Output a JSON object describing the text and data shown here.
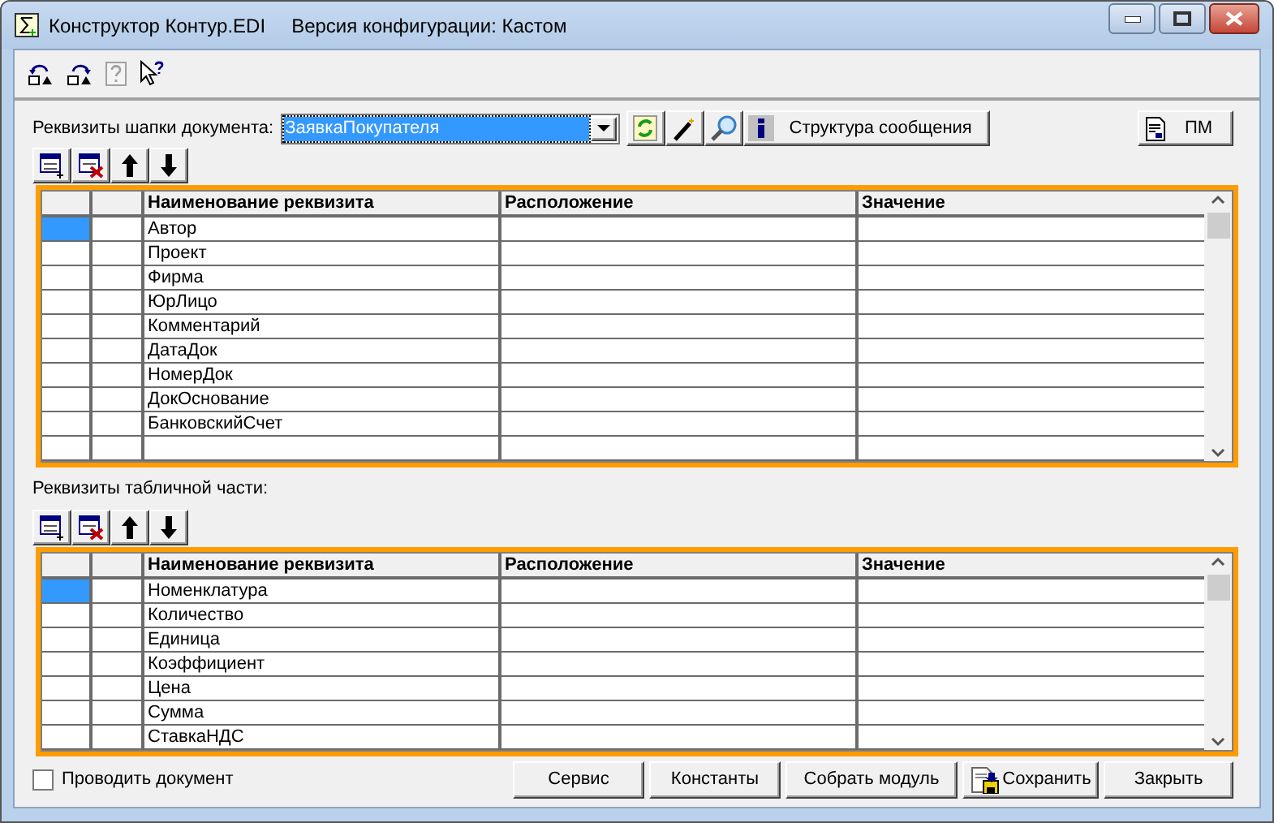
{
  "window": {
    "title": "Конструктор Контур.EDI",
    "config_version": "Версия конфигурации: Кастом"
  },
  "header_section": {
    "label": "Реквизиты шапки документа:",
    "document_type": "ЗаявкаПокупателя",
    "structure_button": "Структура сообщения",
    "pm_button": "ПМ",
    "table": {
      "columns": [
        "Наименование реквизита",
        "Расположение",
        "Значение"
      ],
      "rows": [
        {
          "name": "Автор",
          "selected": true
        },
        {
          "name": "Проект",
          "selected": false
        },
        {
          "name": "Фирма",
          "selected": false
        },
        {
          "name": "ЮрЛицо",
          "selected": false
        },
        {
          "name": "Комментарий",
          "selected": false
        },
        {
          "name": "ДатаДок",
          "selected": false
        },
        {
          "name": "НомерДок",
          "selected": false
        },
        {
          "name": "ДокОснование",
          "selected": false
        },
        {
          "name": "БанковскийСчет",
          "selected": false
        }
      ]
    }
  },
  "table_section": {
    "label": "Реквизиты табличной части:",
    "table": {
      "columns": [
        "Наименование реквизита",
        "Расположение",
        "Значение"
      ],
      "rows": [
        {
          "name": "Номенклатура",
          "selected": true
        },
        {
          "name": "Количество",
          "selected": false
        },
        {
          "name": "Единица",
          "selected": false
        },
        {
          "name": "Коэффициент",
          "selected": false
        },
        {
          "name": "Цена",
          "selected": false
        },
        {
          "name": "Сумма",
          "selected": false
        },
        {
          "name": "СтавкаНДС",
          "selected": false
        }
      ]
    }
  },
  "post_document": {
    "label": "Проводить документ",
    "checked": false
  },
  "buttons": [
    {
      "label": "Сервис",
      "kind": "plain"
    },
    {
      "label": "Константы",
      "kind": "plain"
    },
    {
      "label": "Собрать модуль",
      "kind": "plain"
    },
    {
      "label": "Сохранить",
      "kind": "save"
    },
    {
      "label": "Закрыть",
      "kind": "plain"
    }
  ]
}
